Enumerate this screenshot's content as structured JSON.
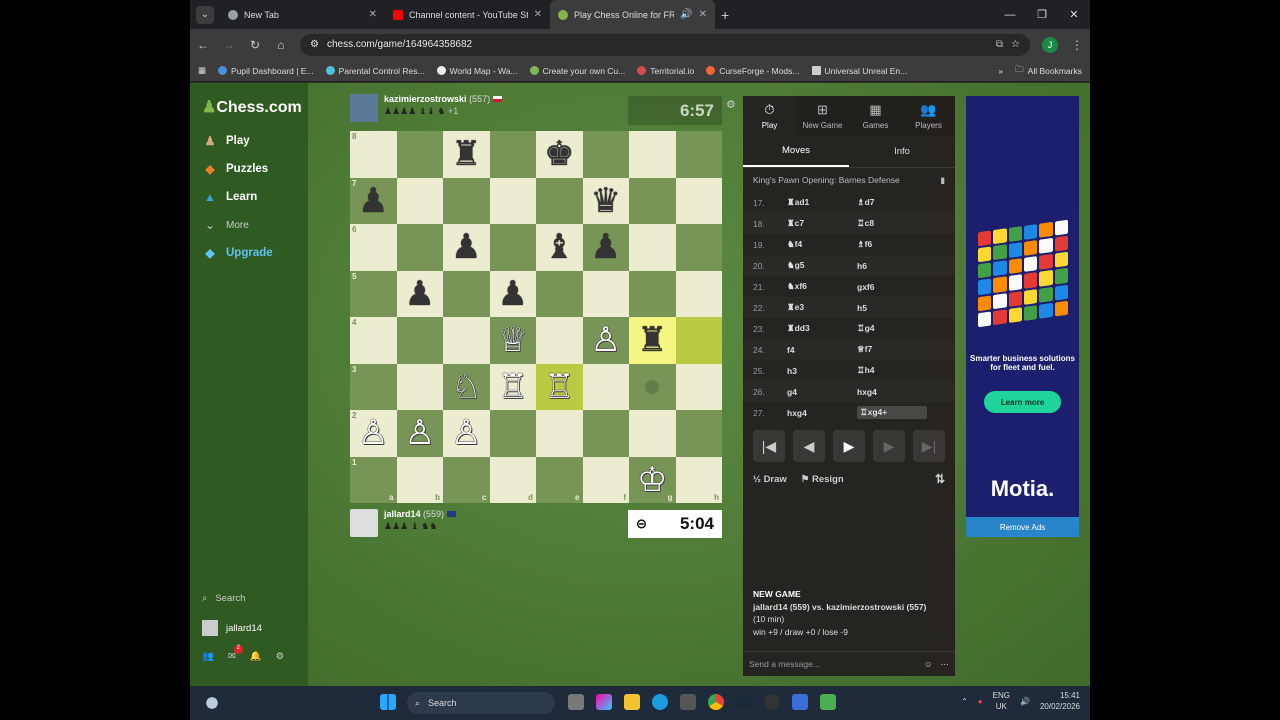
{
  "browser": {
    "tabs": [
      {
        "title": "New Tab",
        "color": "#9aa0a6"
      },
      {
        "title": "Channel content - YouTube Stu",
        "color": "#ff0000"
      },
      {
        "title": "Play Chess Online for FREE",
        "color": "#81b64c"
      }
    ],
    "url": "chess.com/game/164964358682",
    "profile_initial": "J",
    "bookmarks": [
      "Pupil Dashboard | E...",
      "Parental Control Res...",
      "World Map - Wa...",
      "Create your own Cu...",
      "Territorial.io",
      "CurseForge - Mods...",
      "Universal Unreal En..."
    ],
    "all_bookmarks": "All Bookmarks"
  },
  "sidenav": {
    "logo": "Chess.com",
    "items": [
      {
        "label": "Play",
        "icon": "play-icon"
      },
      {
        "label": "Puzzles",
        "icon": "puzzle-icon"
      },
      {
        "label": "Learn",
        "icon": "learn-icon"
      },
      {
        "label": "More",
        "icon": "chevron-down-icon"
      },
      {
        "label": "Upgrade",
        "icon": "diamond-icon"
      }
    ],
    "search": "Search",
    "user": "jallard14",
    "notif_count": "2"
  },
  "game": {
    "top_player": {
      "name": "kazimierzostrowski",
      "rating": "(557)",
      "captures": "♟♟♟♟ ♝♝ ♞",
      "plus": "+1",
      "clock": "6:57"
    },
    "bottom_player": {
      "name": "jallard14",
      "rating": "(559)",
      "captures": "♟♟♟ ♝ ♞♞",
      "clock": "5:04"
    },
    "board": [
      [
        "",
        "",
        "♜",
        "",
        "♚",
        "",
        "",
        ""
      ],
      [
        "♟",
        "",
        "",
        "",
        "",
        "♛",
        "",
        ""
      ],
      [
        "",
        "",
        "♟",
        "",
        "♝",
        "♟",
        "",
        ""
      ],
      [
        "",
        "♟",
        "",
        "♟",
        "",
        "",
        "",
        ""
      ],
      [
        "",
        "",
        "",
        "♕",
        "",
        "♙",
        "♜",
        ""
      ],
      [
        "",
        "",
        "♘",
        "♖",
        "♖",
        "",
        "",
        ""
      ],
      [
        "♙",
        "♙",
        "♙",
        "",
        "",
        "",
        "",
        ""
      ],
      [
        "",
        "",
        "",
        "",
        "",
        "",
        "♔",
        ""
      ]
    ],
    "files": [
      "a",
      "b",
      "c",
      "d",
      "e",
      "f",
      "g",
      "h"
    ],
    "ranks": [
      "8",
      "7",
      "6",
      "5",
      "4",
      "3",
      "2",
      "1"
    ]
  },
  "panel": {
    "tabs": [
      {
        "label": "Play",
        "icon": "stopwatch-icon"
      },
      {
        "label": "New Game",
        "icon": "plus-icon"
      },
      {
        "label": "Games",
        "icon": "board-icon"
      },
      {
        "label": "Players",
        "icon": "players-icon"
      }
    ],
    "subtabs": [
      "Moves",
      "Info"
    ],
    "opening": "King's Pawn Opening: Barnes Defense",
    "moves": [
      {
        "n": "17.",
        "w": "♜ad1",
        "b": "♗d7"
      },
      {
        "n": "18.",
        "w": "♜c7",
        "b": "♖c8"
      },
      {
        "n": "19.",
        "w": "♞f4",
        "b": "♗f6"
      },
      {
        "n": "20.",
        "w": "♞g5",
        "b": "h6"
      },
      {
        "n": "21.",
        "w": "♞xf6",
        "b": "gxf6"
      },
      {
        "n": "22.",
        "w": "♜e3",
        "b": "h5"
      },
      {
        "n": "23.",
        "w": "♜dd3",
        "b": "♖g4"
      },
      {
        "n": "24.",
        "w": "f4",
        "b": "♕f7"
      },
      {
        "n": "25.",
        "w": "h3",
        "b": "♖h4"
      },
      {
        "n": "26.",
        "w": "g4",
        "b": "hxg4"
      },
      {
        "n": "27.",
        "w": "hxg4",
        "b": "♖xg4+"
      }
    ],
    "draw": "Draw",
    "resign": "Resign",
    "new_game": {
      "title": "NEW GAME",
      "players": "jallard14 (559) vs. kazimierzostrowski (557)",
      "time": "(10 min)",
      "stakes": "win +9 / draw +0 / lose -9"
    },
    "message_placeholder": "Send a message..."
  },
  "ad": {
    "text": "Smarter business solutions for fleet and fuel.",
    "button": "Learn more",
    "brand": "Motia.",
    "remove": "Remove Ads"
  },
  "taskbar": {
    "search": "Search",
    "lang1": "ENG",
    "lang2": "UK",
    "time": "15:41",
    "date": "20/02/2026"
  },
  "colors": {
    "brand_green": "#81b64c",
    "board_light": "#ebecd0",
    "board_dark": "#779556"
  }
}
